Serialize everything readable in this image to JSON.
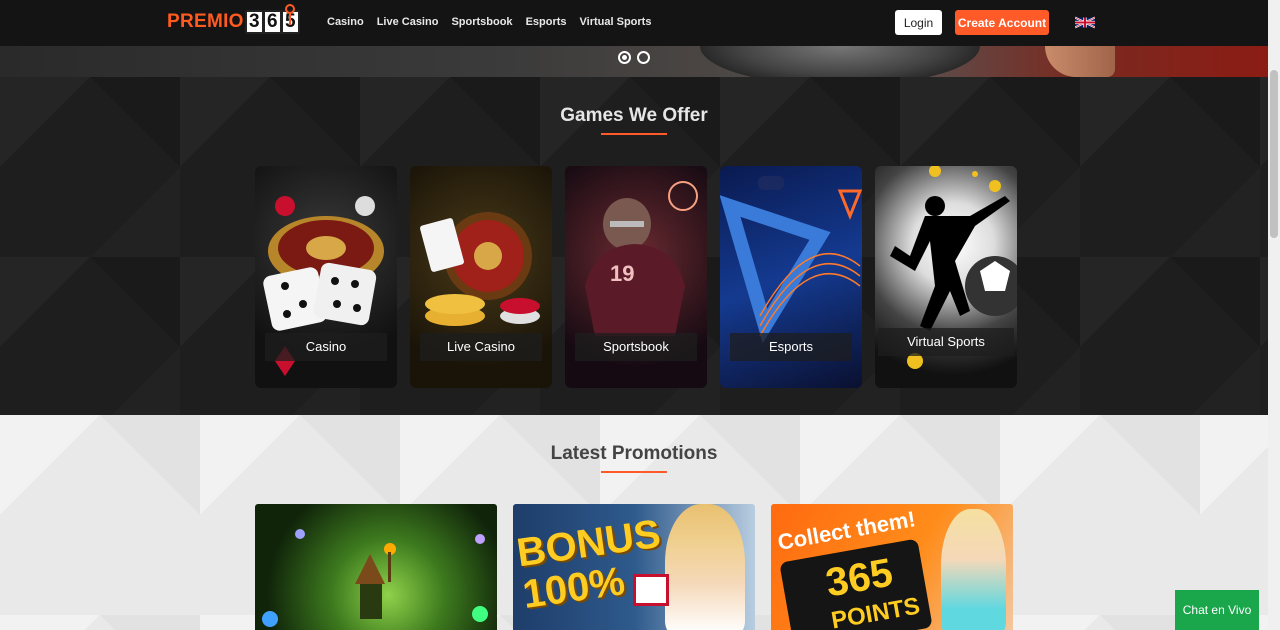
{
  "header": {
    "logo_word": "PREMIO",
    "logo_digits": [
      "3",
      "6",
      "5"
    ],
    "nav": [
      "Casino",
      "Live Casino",
      "Sportsbook",
      "Esports",
      "Virtual Sports"
    ],
    "login_label": "Login",
    "create_account_label": "Create Account",
    "language_icon": "uk-flag-icon"
  },
  "carousel": {
    "slides": 2,
    "active": 0
  },
  "games": {
    "title": "Games We Offer",
    "cards": [
      {
        "label": "Casino"
      },
      {
        "label": "Live Casino"
      },
      {
        "label": "Sportsbook"
      },
      {
        "label": "Esports"
      },
      {
        "label": "Virtual Sports"
      }
    ]
  },
  "promotions": {
    "title": "Latest Promotions",
    "items": [
      {
        "text": ""
      },
      {
        "text": "BONUS 100%"
      },
      {
        "text_top": "Collect them!",
        "text_num": "365",
        "text_bottom": "POINTS"
      }
    ]
  },
  "chat": {
    "label": "Chat en Vivo"
  },
  "colors": {
    "accent": "#ff5a28",
    "chat": "#1aa64a",
    "header_bg": "#141414"
  }
}
